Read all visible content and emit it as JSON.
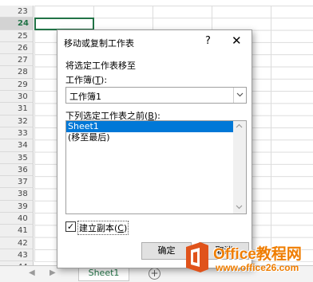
{
  "sheet": {
    "row_numbers": [
      "23",
      "24",
      "25",
      "26",
      "27",
      "28",
      "29",
      "30",
      "31",
      "32",
      "33",
      "34",
      "35",
      "36",
      "37",
      "38",
      "39",
      "40",
      "41",
      "42",
      "43",
      "44"
    ],
    "selected_row": "24",
    "tab_label": "Sheet1",
    "add_sheet_symbol": "+",
    "nav_prev": "◀",
    "nav_next": "▶"
  },
  "dialog": {
    "title": "移动或复制工作表",
    "help": "?",
    "close": "✕",
    "move_label": "将选定工作表移至",
    "book_label_pre": "工作簿(",
    "book_label_key": "T",
    "book_label_post": "):",
    "book_value": "工作簿1",
    "before_label_pre": "下列选定工作表之前(",
    "before_label_key": "B",
    "before_label_post": "):",
    "sheet_list": [
      "Sheet1",
      "(移至最后)"
    ],
    "selected_index": 0,
    "copy_label_pre": "建立副本(",
    "copy_label_key": "C",
    "copy_label_post": ")",
    "copy_checked": true,
    "ok_label": "确定",
    "cancel_label": "取消"
  },
  "watermark": {
    "title": "Office教程网",
    "url": "www.office26.com"
  },
  "colors": {
    "excel_green": "#217346",
    "selection_blue": "#0078d7",
    "watermark_orange": "#ef7d00"
  }
}
